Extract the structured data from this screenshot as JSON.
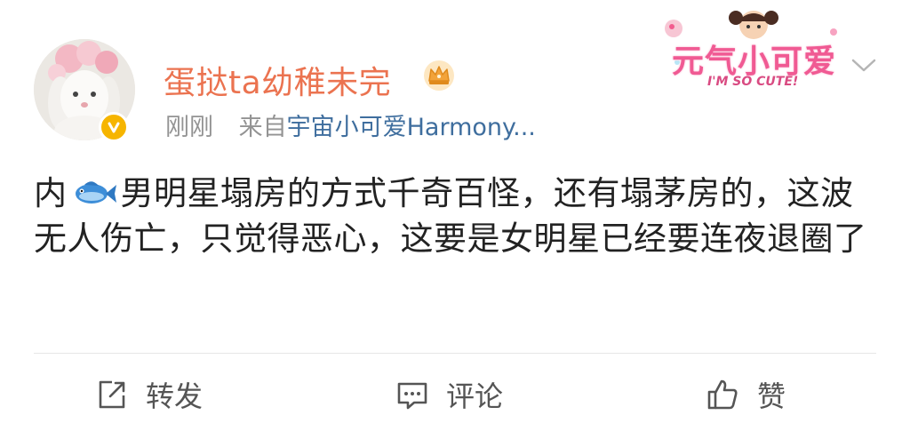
{
  "post": {
    "username": "蛋挞ta幼稚未完",
    "time": "刚刚",
    "source_prefix": "来自",
    "source_device": "宇宙小可爱Harmony...",
    "content_before_icon": "内",
    "content_after_icon": "男明星塌房的方式千奇百怪，还有塌茅房的，这波无人伤亡，只觉得恶心，这要是女明星已经要连夜退圈了",
    "content_icon": "fish-emoji-icon"
  },
  "sticker": {
    "main_text": "元气小可爱",
    "sub_text": "I'M SO CUTE!"
  },
  "actions": {
    "repost_label": "转发",
    "comment_label": "评论",
    "like_label": "赞"
  },
  "colors": {
    "username": "#eb7350",
    "device": "#3f6e9e",
    "meta": "#939393",
    "text": "#222222",
    "verified": "#f6b500"
  }
}
